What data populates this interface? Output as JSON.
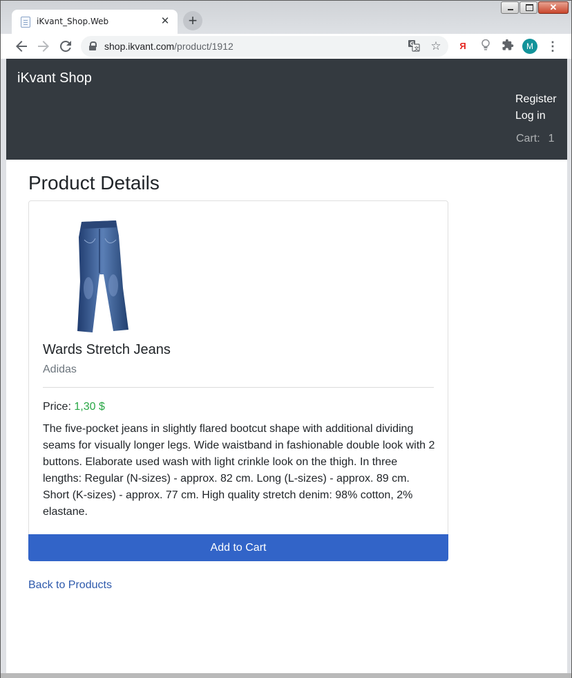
{
  "browser": {
    "tab_title": "iKvant_Shop.Web",
    "tab_close": "✕",
    "new_tab": "+",
    "url_host": "shop.ikvant.com",
    "url_path": "/product/1912",
    "nav_icons": {
      "back": "back-arrow-icon",
      "forward": "forward-arrow-icon",
      "reload": "reload-icon"
    },
    "extensions": [
      "yandex-icon",
      "lightbulb-icon",
      "puzzle-icon"
    ],
    "yandex_glyph": "Я",
    "profile_initial": "M",
    "profile_color": "#12939a"
  },
  "site": {
    "brand": "iKvant Shop",
    "nav": {
      "register": "Register",
      "login": "Log in",
      "cart_label": "Cart:",
      "cart_count": "1"
    },
    "header_color": "#343a40"
  },
  "product": {
    "heading": "Product Details",
    "name": "Wards Stretch Jeans",
    "brand": "Adidas",
    "price_label": "Price:",
    "price_value": "1,30 $",
    "description": "The five-pocket jeans in slightly flared bootcut shape with additional dividing seams for visually longer legs. Wide waistband in fashionable double look with 2 buttons. Elaborate used wash with light crinkle look on the thigh. In three lengths: Regular (N-sizes) - approx. 82 cm. Long (L-sizes) - approx. 89 cm. Short (K-sizes) - approx. 77 cm. High quality stretch denim: 98% cotton, 2% elastane.",
    "add_to_cart_label": "Add to Cart",
    "accent_color": "#3264c8",
    "price_color": "#28a745"
  },
  "footer_link": {
    "back": "Back to Products"
  }
}
